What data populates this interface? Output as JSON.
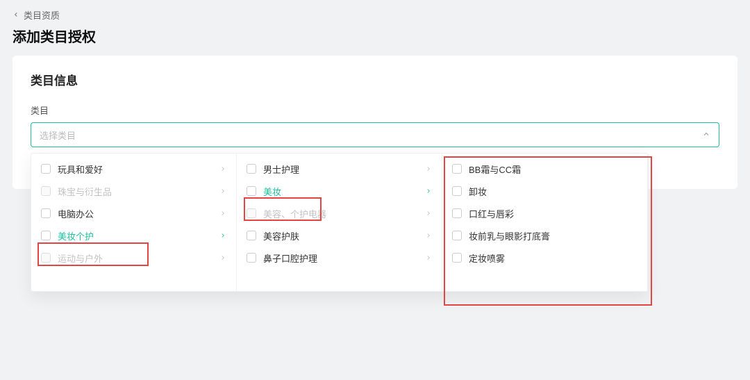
{
  "breadcrumb": {
    "parent": "类目资质"
  },
  "page": {
    "title": "添加类目授权"
  },
  "form": {
    "section_title": "类目信息",
    "category_label": "类目",
    "placeholder": "选择类目"
  },
  "cascader": {
    "col1": [
      {
        "label": "玩具和爱好",
        "disabled": false,
        "arrow": true,
        "selected": false
      },
      {
        "label": "珠宝与衍生品",
        "disabled": true,
        "arrow": true,
        "selected": false
      },
      {
        "label": "电脑办公",
        "disabled": false,
        "arrow": true,
        "selected": false
      },
      {
        "label": "美妆个护",
        "disabled": false,
        "arrow": true,
        "selected": true
      },
      {
        "label": "运动与户外",
        "disabled": true,
        "arrow": true,
        "selected": false
      }
    ],
    "col2": [
      {
        "label": "男士护理",
        "disabled": false,
        "arrow": true,
        "selected": false
      },
      {
        "label": "美妆",
        "disabled": false,
        "arrow": true,
        "selected": true
      },
      {
        "label": "美容、个护电器",
        "disabled": true,
        "arrow": true,
        "selected": false
      },
      {
        "label": "美容护肤",
        "disabled": false,
        "arrow": true,
        "selected": false
      },
      {
        "label": "鼻子口腔护理",
        "disabled": false,
        "arrow": true,
        "selected": false
      }
    ],
    "col3": [
      {
        "label": "BB霜与CC霜",
        "disabled": false,
        "arrow": false,
        "selected": false
      },
      {
        "label": "卸妆",
        "disabled": false,
        "arrow": false,
        "selected": false
      },
      {
        "label": "口红与唇彩",
        "disabled": false,
        "arrow": false,
        "selected": false
      },
      {
        "label": "妆前乳与眼影打底膏",
        "disabled": false,
        "arrow": false,
        "selected": false
      },
      {
        "label": "定妆喷雾",
        "disabled": false,
        "arrow": false,
        "selected": false
      }
    ]
  }
}
